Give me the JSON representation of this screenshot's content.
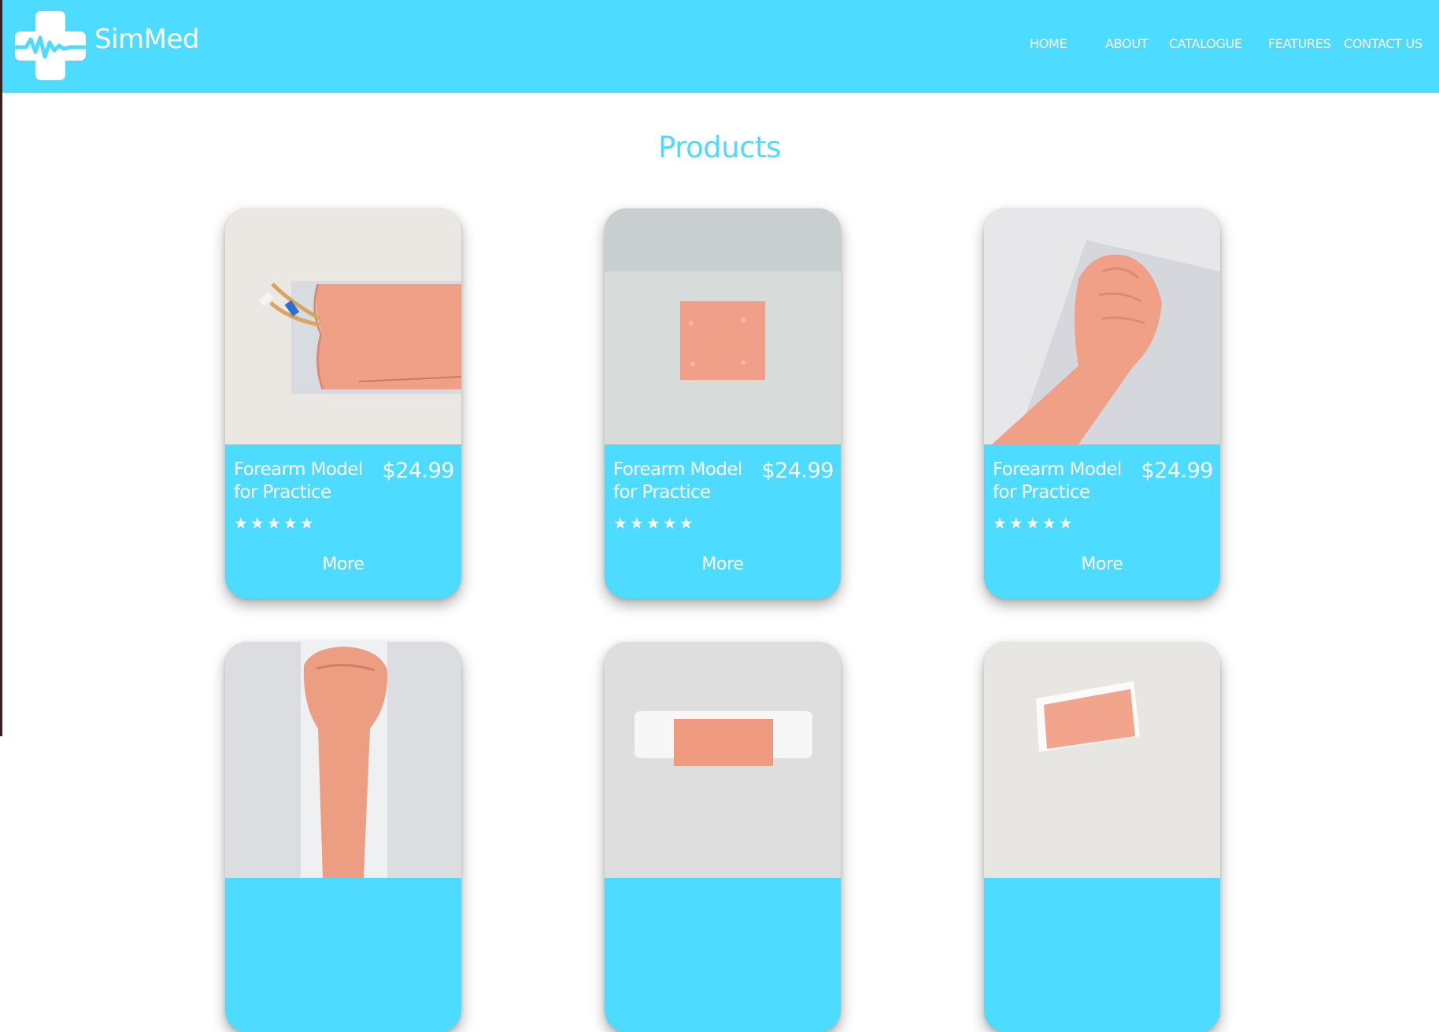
{
  "header": {
    "brand": "SimMed",
    "nav": [
      "HOME",
      "ABOUT",
      "CATALOGUE",
      "FEATURES",
      "CONTACT US"
    ]
  },
  "section_title": "Products",
  "products": [
    {
      "name": "Forearm Model for Practice",
      "price": "$24.99",
      "rating": 5,
      "stars": "★★★★★",
      "more": "More",
      "image": "iv-forearm-with-tubing"
    },
    {
      "name": "Forearm Model for Practice",
      "price": "$24.99",
      "rating": 5,
      "stars": "★★★★★",
      "more": "More",
      "image": "skin-pad-square"
    },
    {
      "name": "Forearm Model for Practice",
      "price": "$24.99",
      "rating": 5,
      "stars": "★★★★★",
      "more": "More",
      "image": "arm-fist-model"
    },
    {
      "image": "raised-fist-model"
    },
    {
      "image": "skin-pad-on-base"
    },
    {
      "image": "skin-pad-tilted"
    }
  ],
  "colors": {
    "accent": "#4ddbff",
    "text_on_accent": "#ffffff"
  }
}
